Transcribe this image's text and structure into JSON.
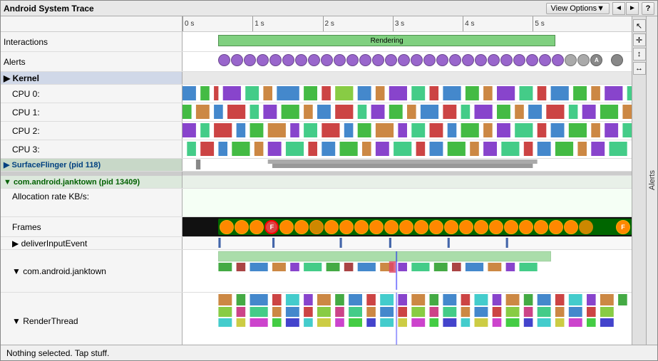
{
  "title": "Android System Trace",
  "toolbar": {
    "view_options_label": "View Options▼",
    "nav_left": "◄",
    "nav_right": "►",
    "help": "?"
  },
  "ruler": {
    "ticks": [
      {
        "label": "0 s",
        "pct": 0
      },
      {
        "label": "1 s",
        "pct": 15.6
      },
      {
        "label": "2 s",
        "pct": 31.2
      },
      {
        "label": "3 s",
        "pct": 46.8
      },
      {
        "label": "4 s",
        "pct": 62.4
      },
      {
        "label": "5 s",
        "pct": 78
      }
    ]
  },
  "rows": {
    "interactions_label": "Interactions",
    "alerts_label": "Alerts",
    "kernel_label": "▶ Kernel",
    "cpu0_label": "CPU 0:",
    "cpu1_label": "CPU 1:",
    "cpu2_label": "CPU 2:",
    "cpu3_label": "CPU 3:",
    "surfaceflinger_label": "▶ SurfaceFlinger (pid 118)",
    "janktown_label": "▼ com.android.janktown (pid 13409)",
    "allocation_label": "Allocation rate KB/s:",
    "frames_label": "Frames",
    "deliver_label": "▶ deliverInputEvent",
    "android_label": "▼ com.android.janktown",
    "renderthread_label": "▼ RenderThread"
  },
  "sidebar": {
    "alerts_label": "Alerts"
  },
  "status": {
    "text": "Nothing selected. Tap stuff."
  },
  "rendering_label": "Rendering"
}
